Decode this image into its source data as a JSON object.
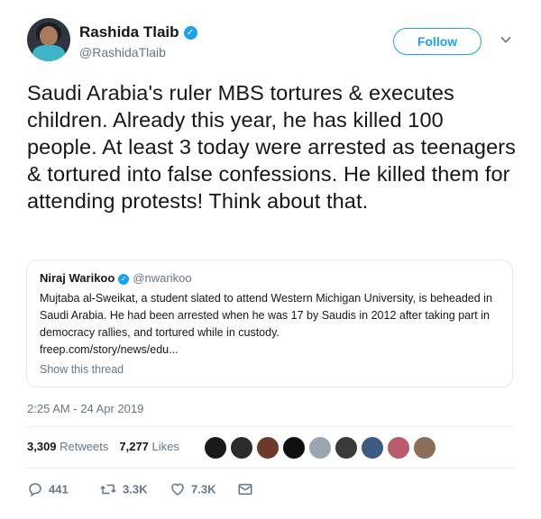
{
  "author": {
    "display_name": "Rashida Tlaib",
    "handle": "@RashidaTlaib",
    "verified": true
  },
  "follow_label": "Follow",
  "tweet_text": "Saudi Arabia's ruler MBS tortures & executes children. Already this year, he has killed 100 people. At least 3 today were arrested as teenagers & tortured into false confessions. He killed them for attending protests! Think about that.",
  "quote": {
    "display_name": "Niraj Warikoo",
    "handle": "@nwarikoo",
    "text": "Mujtaba al-Sweikat, a student slated to attend Western Michigan University, is beheaded in Saudi Arabia. He had been arrested when he was 17 by Saudis in 2012 after taking part in democracy rallies, and tortured while in custody.",
    "link": "freep.com/story/news/edu...",
    "show_thread": "Show this thread"
  },
  "timestamp": "2:25 AM - 24 Apr 2019",
  "stats": {
    "retweets_count": "3,309",
    "retweets_label": "Retweets",
    "likes_count": "7,277",
    "likes_label": "Likes"
  },
  "likers": [
    "#1a1a1a",
    "#2b2b2b",
    "#6b3a2a",
    "#0f0f0f",
    "#9aa5b1",
    "#3a3a3a",
    "#3d5a80",
    "#b85c6b",
    "#8a6e5a"
  ],
  "actions": {
    "reply_count": "441",
    "retweet_count": "3.3K",
    "like_count": "7.3K"
  },
  "colors": {
    "accent": "#1da1f2",
    "secondary_text": "#657786",
    "border": "#e1e8ed"
  }
}
